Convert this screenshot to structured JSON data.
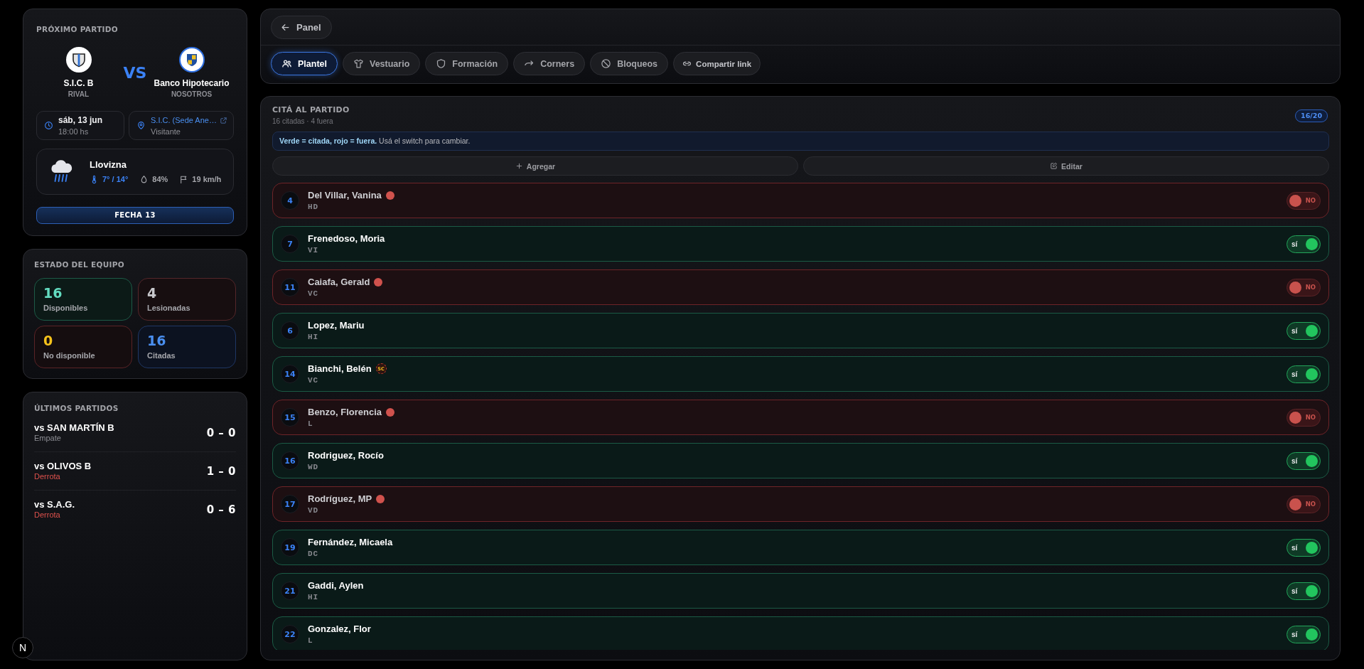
{
  "next_match": {
    "title": "PRÓXIMO PARTIDO",
    "rival": {
      "name": "S.I.C. B",
      "role": "RIVAL"
    },
    "vs": "VS",
    "own": {
      "name": "Banco Hipotecario",
      "role": "NOSOTROS"
    },
    "date": "sáb, 13 jun",
    "time": "18:00 hs",
    "venue": "S.I.C. (Sede Ane…",
    "venue_type": "Visitante",
    "weather": {
      "condition": "Llovizna",
      "temperature": "7° / 14°",
      "humidity": "84%",
      "wind": "19 km/h"
    },
    "round_button": "FECHA 13"
  },
  "team_status": {
    "title": "ESTADO DEL EQUIPO",
    "stats": [
      {
        "value": "16",
        "label": "Disponibles",
        "kind": "available"
      },
      {
        "value": "4",
        "label": "Lesionadas",
        "kind": "injured"
      },
      {
        "value": "0",
        "label": "No disponible",
        "kind": "unavailable"
      },
      {
        "value": "16",
        "label": "Citadas",
        "kind": "cited"
      }
    ]
  },
  "recent_matches": {
    "title": "ÚLTIMOS PARTIDOS",
    "matches": [
      {
        "opponent": "vs SAN MARTÍN B",
        "result": "Empate",
        "kind": "draw",
        "score": "0 – 0"
      },
      {
        "opponent": "vs OLIVOS B",
        "result": "Derrota",
        "kind": "loss",
        "score": "1 – 0"
      },
      {
        "opponent": "vs S.A.G.",
        "result": "Derrota",
        "kind": "loss",
        "score": "0 – 6"
      }
    ]
  },
  "dev_badge": "N",
  "toolbar": {
    "back_button": "Panel",
    "tabs": [
      {
        "label": "Plantel",
        "kind": "squad",
        "selected": true
      },
      {
        "label": "Vestuario",
        "kind": "kit",
        "selected": false
      },
      {
        "label": "Formación",
        "kind": "formation",
        "selected": false
      },
      {
        "label": "Corners",
        "kind": "corners",
        "selected": false
      },
      {
        "label": "Bloqueos",
        "kind": "blocks",
        "selected": false
      }
    ],
    "share_button": "Compartir link"
  },
  "call_up": {
    "title": "CITÁ AL PARTIDO",
    "summary": "16 citadas · 4 fuera",
    "count_badge": "16/20",
    "hint": "**Verde = citada, rojo = fuera.** Usá el switch para cambiar.",
    "add_button": "Agregar",
    "edit_button": "Editar",
    "players": [
      {
        "number": "4",
        "name": "Del Villar, Vanina",
        "position": "HD",
        "injured": true,
        "on": false,
        "switch_label": "NO"
      },
      {
        "number": "7",
        "name": "Frenedoso, Moria",
        "position": "VI",
        "injured": false,
        "on": true,
        "switch_label": "sí"
      },
      {
        "number": "11",
        "name": "Caiafa, Gerald",
        "position": "VC",
        "injured": true,
        "on": false,
        "switch_label": "NO"
      },
      {
        "number": "6",
        "name": "Lopez, Mariu",
        "position": "HI",
        "injured": false,
        "on": true,
        "switch_label": "sí"
      },
      {
        "number": "14",
        "name": "Bianchi, Belén",
        "position": "VC",
        "injured": false,
        "badge": "SC",
        "on": true,
        "switch_label": "sí"
      },
      {
        "number": "15",
        "name": "Benzo, Florencia",
        "position": "L",
        "injured": true,
        "on": false,
        "switch_label": "NO"
      },
      {
        "number": "16",
        "name": "Rodriguez, Rocío",
        "position": "WD",
        "injured": false,
        "on": true,
        "switch_label": "sí"
      },
      {
        "number": "17",
        "name": "Rodríguez, MP",
        "position": "VD",
        "injured": true,
        "on": false,
        "switch_label": "NO"
      },
      {
        "number": "19",
        "name": "Fernández, Micaela",
        "position": "DC",
        "injured": false,
        "on": true,
        "switch_label": "sí"
      },
      {
        "number": "21",
        "name": "Gaddi, Aylen",
        "position": "HI",
        "injured": false,
        "on": true,
        "switch_label": "sí"
      },
      {
        "number": "22",
        "name": "Gonzalez, Flor",
        "position": "L",
        "injured": false,
        "on": true,
        "switch_label": "sí"
      }
    ]
  }
}
